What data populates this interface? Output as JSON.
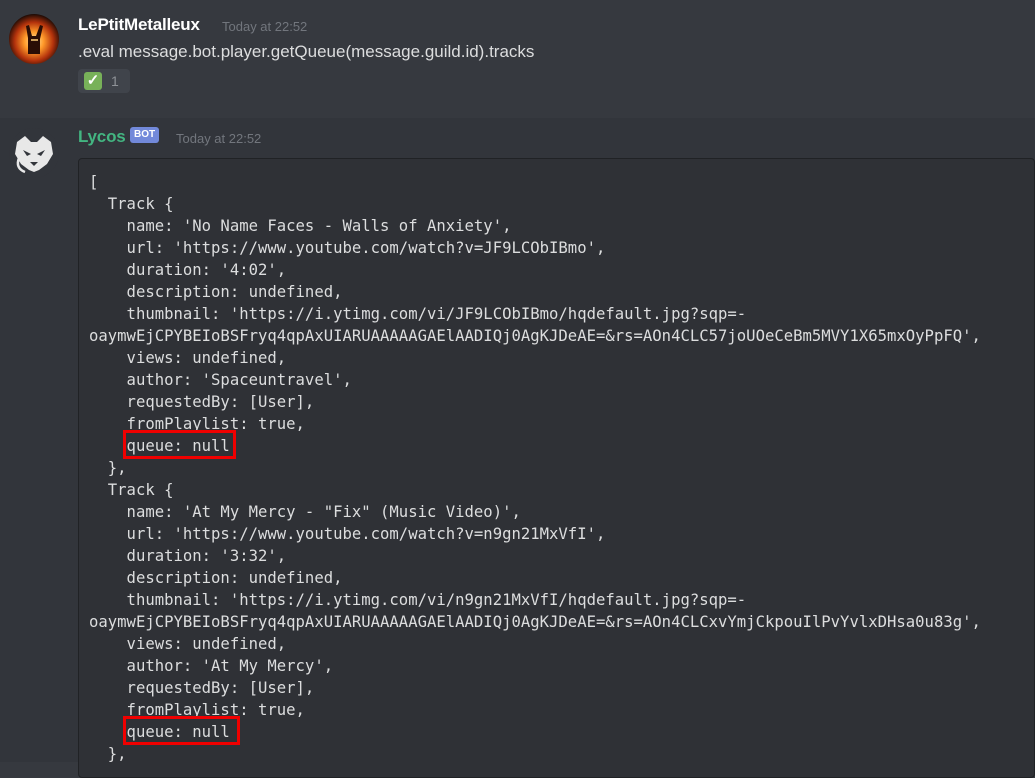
{
  "messages": [
    {
      "author": "LePtitMetalleux",
      "timestamp": "Today at 22:52",
      "avatar_icon": "metal-hand-avatar",
      "content": ".eval message.bot.player.getQueue(message.guild.id).tracks",
      "reaction": {
        "emoji": "✓",
        "emoji_name": "white-check-mark",
        "count": "1"
      }
    },
    {
      "author": "Lycos",
      "author_color": "#43b581",
      "badge": "BOT",
      "timestamp": "Today at 22:52",
      "avatar_icon": "wolf-avatar",
      "code_lines": [
        "[",
        "  Track {",
        "    name: 'No Name Faces - Walls of Anxiety',",
        "    url: 'https://www.youtube.com/watch?v=JF9LCObIBmo',",
        "    duration: '4:02',",
        "    description: undefined,",
        "    thumbnail: 'https://i.ytimg.com/vi/JF9LCObIBmo/hqdefault.jpg?sqp=-",
        "oaymwEjCPYBEIoBSFryq4qpAxUIARUAAAAAGAElAADIQj0AgKJDeAE=&rs=AOn4CLC57joUOeCeBm5MVY1X65mxOyPpFQ',",
        "    views: undefined,",
        "    author: 'Spaceuntravel',",
        "    requestedBy: [User],",
        "    fromPlaylist: true,",
        "    queue: null",
        "  },",
        "  Track {",
        "    name: 'At My Mercy - \"Fix\" (Music Video)',",
        "    url: 'https://www.youtube.com/watch?v=n9gn21MxVfI',",
        "    duration: '3:32',",
        "    description: undefined,",
        "    thumbnail: 'https://i.ytimg.com/vi/n9gn21MxVfI/hqdefault.jpg?sqp=-",
        "oaymwEjCPYBEIoBSFryq4qpAxUIARUAAAAAGAElAADIQj0AgKJDeAE=&rs=AOn4CLCxvYmjCkpouIlPvYvlxDHsa0u83g',",
        "    views: undefined,",
        "    author: 'At My Mercy',",
        "    requestedBy: [User],",
        "    fromPlaylist: true,",
        "    queue: null",
        "  },"
      ],
      "highlight_color": "#f00000"
    }
  ]
}
